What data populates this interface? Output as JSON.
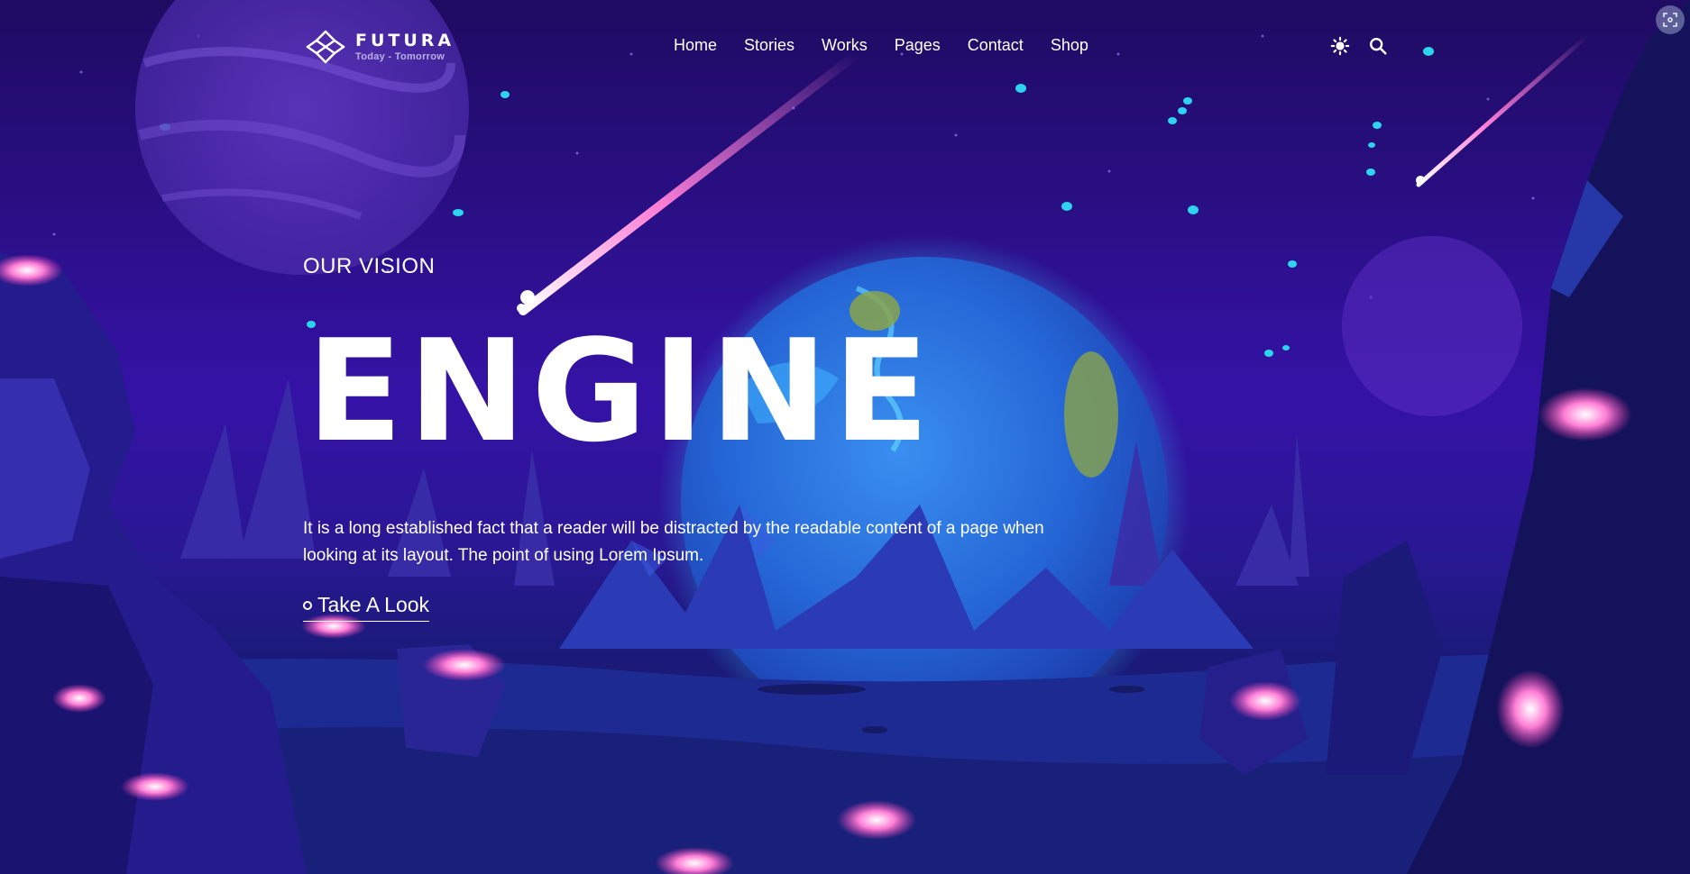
{
  "brand": {
    "name": "FUTURA",
    "tagline": "Today - Tomorrow"
  },
  "nav": {
    "items": [
      {
        "label": "Home"
      },
      {
        "label": "Stories"
      },
      {
        "label": "Works"
      },
      {
        "label": "Pages"
      },
      {
        "label": "Contact"
      },
      {
        "label": "Shop"
      }
    ]
  },
  "header_icons": [
    "theme-toggle-icon",
    "search-icon"
  ],
  "hero": {
    "eyebrow": "OUR VISION",
    "headline": "ENGINE",
    "description": "It is a long established fact that a reader will be distracted by the readable content of a page when looking at its layout. The point of using Lorem Ipsum.",
    "cta_label": "Take A Look"
  },
  "colors": {
    "sky_top": "#1f0b62",
    "sky_mid": "#3512a6",
    "planet": "#2f7ce8",
    "glow_pink": "#ff5fc8",
    "star_cyan": "#2ed3f0",
    "text": "#ffffff"
  }
}
